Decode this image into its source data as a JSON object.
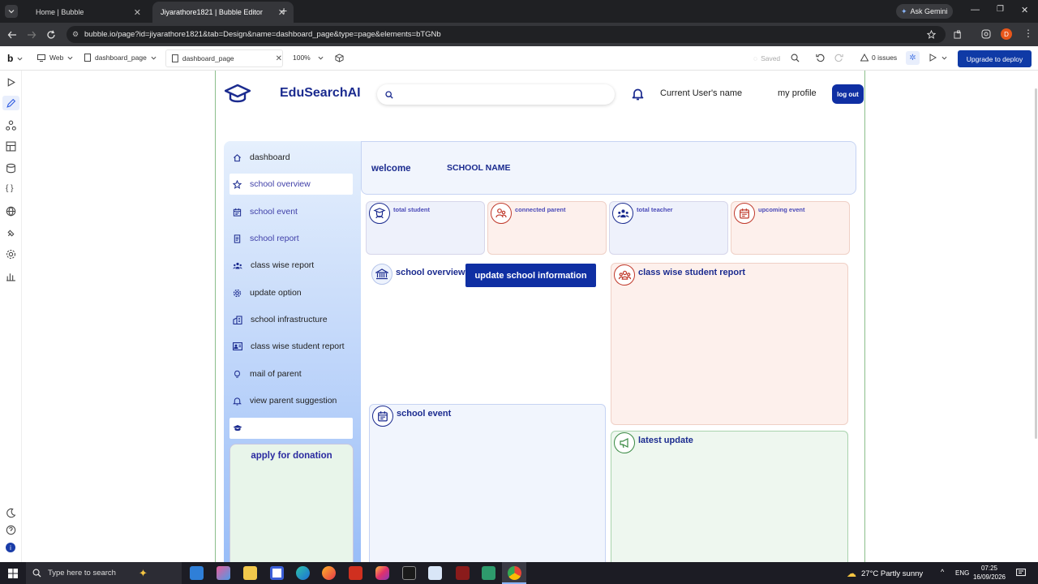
{
  "browser": {
    "tabs": [
      {
        "label": "Home | Bubble"
      },
      {
        "label": "Jiyarathore1821 | Bubble Editor"
      }
    ],
    "ask_gemini": "Ask Gemini",
    "url": "bubble.io/page?id=jiyarathore1821&tab=Design&name=dashboard_page&type=page&elements=bTGNb",
    "profile_initial": "D"
  },
  "editor": {
    "logo": "b",
    "device": "Web",
    "page_select": "dashboard_page",
    "page_tab": "dashboard_page",
    "zoom": "100%",
    "saved": "Saved",
    "issues": "0 issues",
    "deploy": "Upgrade to deploy"
  },
  "app": {
    "brand": "EduSearchAI",
    "search_placeholder": "",
    "user_name": "Current User's name",
    "my_profile": "my profile",
    "logout": "log out",
    "sidebar": [
      {
        "label": "dashboard",
        "icon": "home-icon"
      },
      {
        "label": "school overview",
        "icon": "star-icon"
      },
      {
        "label": "school event",
        "icon": "calendar-icon"
      },
      {
        "label": "school report",
        "icon": "document-icon"
      },
      {
        "label": "class wise report",
        "icon": "group-icon"
      },
      {
        "label": "update option",
        "icon": "gear-icon"
      },
      {
        "label": "school infrastructure",
        "icon": "building-icon"
      },
      {
        "label": "class wise student report",
        "icon": "id-card-icon"
      },
      {
        "label": "mail of parent",
        "icon": "lightbulb-icon"
      },
      {
        "label": "view parent suggestion",
        "icon": "bell-icon"
      },
      {
        "label": "",
        "icon": "graduation-cap-icon"
      }
    ],
    "donation_title": "apply for donation",
    "welcome": "welcome",
    "school_name": "SCHOOL NAME",
    "stats": [
      {
        "label": "total student",
        "color": "#1b2b8f",
        "bg": "#eef1fb"
      },
      {
        "label": "connected parent",
        "color": "#c0392b",
        "bg": "#fdf0ec"
      },
      {
        "label": "total teacher",
        "color": "#1b2b8f",
        "bg": "#eef1fb"
      },
      {
        "label": "upcoming event",
        "color": "#c0392b",
        "bg": "#fdf0ec"
      }
    ],
    "school_overview": "school overview",
    "update_school": "update school information",
    "class_report": "class wise student report",
    "school_event": "school event",
    "latest_update": "latest update"
  },
  "taskbar": {
    "search": "Type here to search",
    "weather": "27°C  Partly sunny",
    "lang": "ENG",
    "time": "07:25",
    "date": "16/09/2026"
  }
}
